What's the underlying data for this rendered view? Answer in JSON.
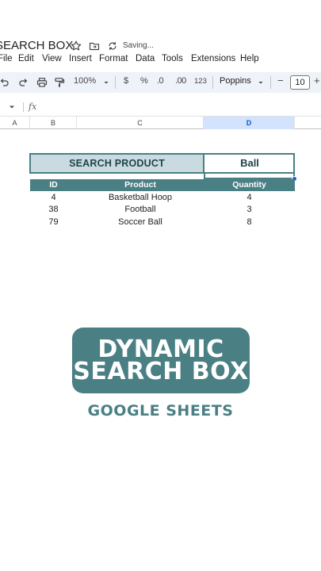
{
  "app": {
    "doc_title": "SEARCH BOX",
    "saving_status": "Saving..."
  },
  "menu": [
    "File",
    "Edit",
    "View",
    "Insert",
    "Format",
    "Data",
    "Tools",
    "Extensions",
    "Help"
  ],
  "toolbar": {
    "zoom": "100%",
    "currency": "$",
    "percent": "%",
    "decrease_decimal": ".0",
    "increase_decimal": ".00",
    "format_123": "123",
    "font": "Poppins",
    "font_size": "10",
    "minus": "−",
    "plus": "+"
  },
  "formula_bar": {
    "fx": "fx"
  },
  "columns": [
    "A",
    "B",
    "C",
    "D"
  ],
  "selected_column": "D",
  "search": {
    "label": "SEARCH PRODUCT",
    "value": "Ball"
  },
  "table": {
    "headers": [
      "ID",
      "Product",
      "Quantity"
    ],
    "rows": [
      [
        "4",
        "Basketball Hoop",
        "4"
      ],
      [
        "38",
        "Football",
        "3"
      ],
      [
        "79",
        "Soccer Ball",
        "8"
      ]
    ]
  },
  "banner": {
    "line1": "DYNAMIC",
    "line2": "SEARCH BOX",
    "subtitle": "GOOGLE SHEETS"
  },
  "colors": {
    "accent": "#4a7f84",
    "label_bg": "#c9dbe0",
    "selected_col": "#d3e3fd",
    "toolbar_bg": "#eef2f9"
  }
}
